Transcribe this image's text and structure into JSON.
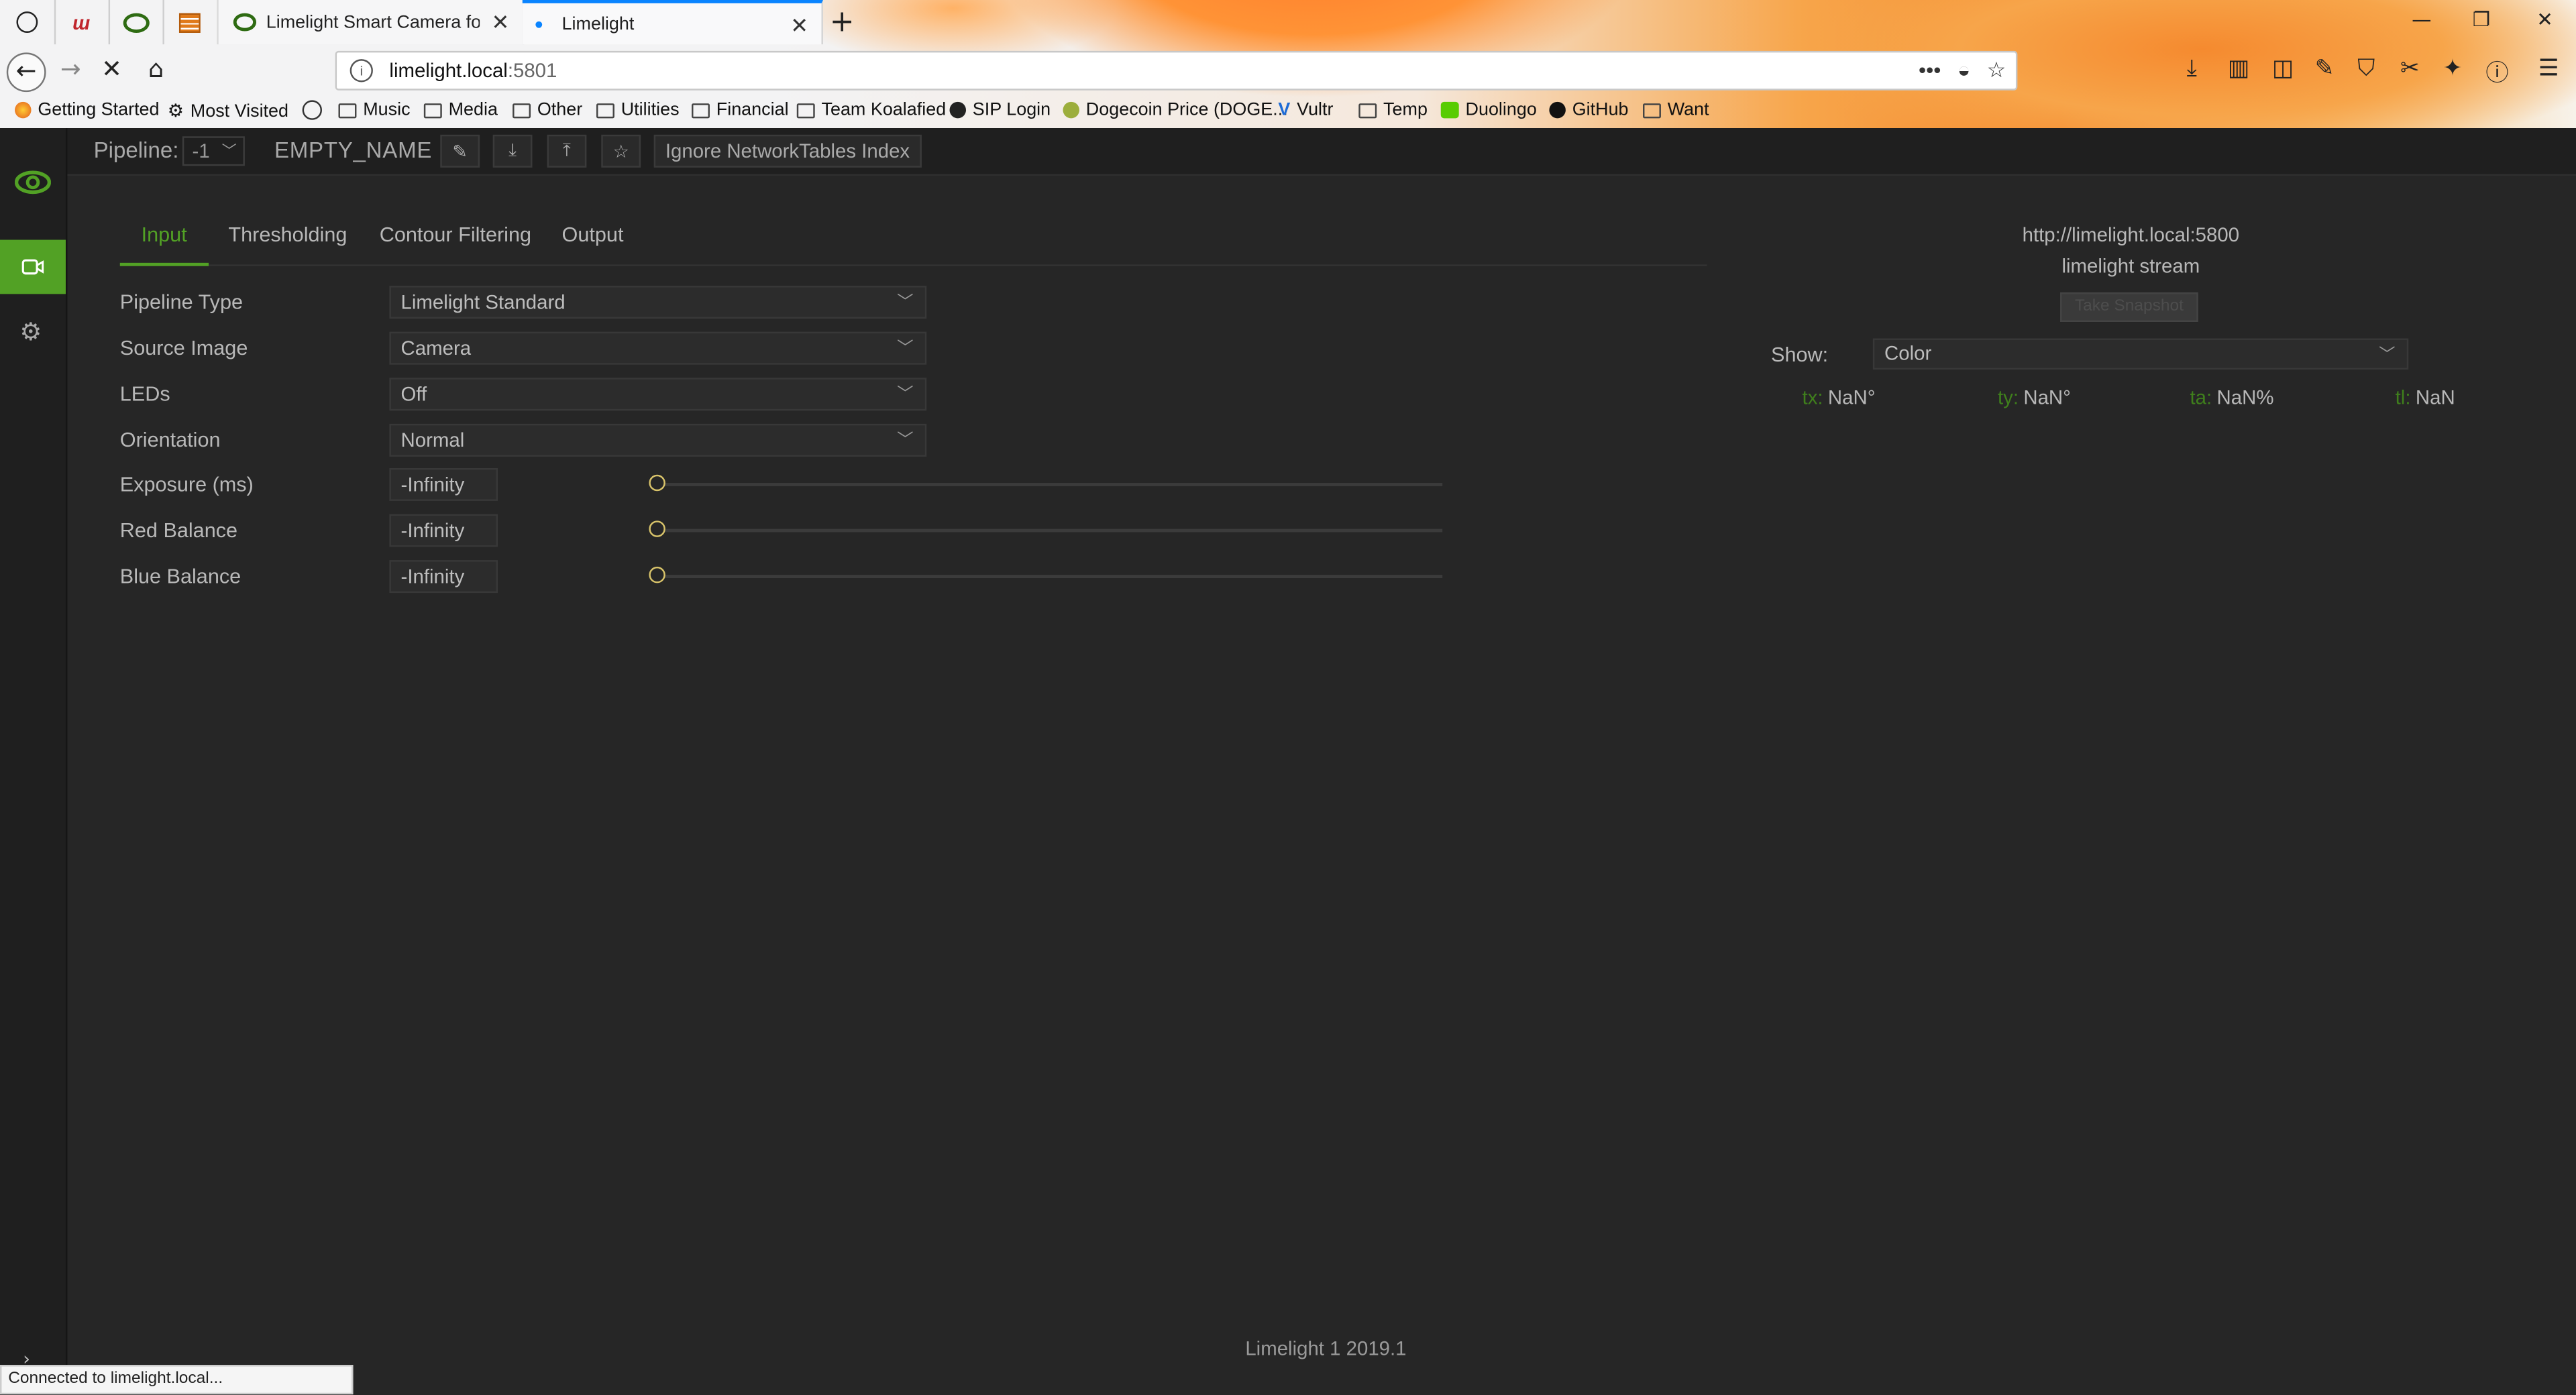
{
  "browser": {
    "tabs": [
      {
        "title": "",
        "icon": "globe-icon",
        "pinned": true
      },
      {
        "title": "",
        "icon": "red-app-icon",
        "pinned": true
      },
      {
        "title": "",
        "icon": "limelight-eye-icon",
        "pinned": true
      },
      {
        "title": "",
        "icon": "orange-app-icon",
        "pinned": true
      },
      {
        "title": "Limelight Smart Camera for FRC",
        "icon": "limelight-eye-icon",
        "pinned": false
      },
      {
        "title": "Limelight",
        "icon": "loading-dot-icon",
        "pinned": false,
        "active": true
      }
    ],
    "url_host": "limelight.local",
    "url_port": ":5801",
    "bookmarks": [
      {
        "label": "Getting Started",
        "icon": "firefox-icon"
      },
      {
        "label": "Most Visited",
        "icon": "gear-icon"
      },
      {
        "label": "",
        "icon": "globe-icon"
      },
      {
        "label": "Music",
        "icon": "folder-icon"
      },
      {
        "label": "Media",
        "icon": "folder-icon"
      },
      {
        "label": "Other",
        "icon": "folder-icon"
      },
      {
        "label": "Utilities",
        "icon": "folder-icon"
      },
      {
        "label": "Financial",
        "icon": "folder-icon"
      },
      {
        "label": "Team Koalafied",
        "icon": "folder-icon"
      },
      {
        "label": "SIP Login",
        "icon": "sip-icon"
      },
      {
        "label": "Dogecoin Price (DOGE...",
        "icon": "dogecoin-icon"
      },
      {
        "label": "Vultr",
        "icon": "vultr-icon"
      },
      {
        "label": "Temp",
        "icon": "folder-icon"
      },
      {
        "label": "Duolingo",
        "icon": "duolingo-icon"
      },
      {
        "label": "GitHub",
        "icon": "github-icon"
      },
      {
        "label": "Want",
        "icon": "folder-icon"
      }
    ],
    "status_text": "Connected to limelight.local..."
  },
  "topbar": {
    "pipeline_label": "Pipeline:",
    "pipeline_index": "-1",
    "pipeline_name": "EMPTY_NAME",
    "ignore_nt_label": "Ignore NetworkTables Index"
  },
  "tabs": [
    "Input",
    "Thresholding",
    "Contour Filtering",
    "Output"
  ],
  "form": {
    "pipeline_type": {
      "label": "Pipeline Type",
      "value": "Limelight Standard"
    },
    "source_image": {
      "label": "Source Image",
      "value": "Camera"
    },
    "leds": {
      "label": "LEDs",
      "value": "Off"
    },
    "orientation": {
      "label": "Orientation",
      "value": "Normal"
    },
    "exposure": {
      "label": "Exposure (ms)",
      "value": "-Infinity"
    },
    "red_balance": {
      "label": "Red Balance",
      "value": "-Infinity"
    },
    "blue_balance": {
      "label": "Blue Balance",
      "value": "-Infinity"
    }
  },
  "stream": {
    "url": "http://limelight.local:5800",
    "name": "limelight stream",
    "snapshot_label": "Take Snapshot",
    "show_label": "Show:",
    "show_value": "Color",
    "stats": [
      {
        "key": "tx:",
        "value": "NaN°"
      },
      {
        "key": "ty:",
        "value": "NaN°"
      },
      {
        "key": "ta:",
        "value": "NaN%"
      },
      {
        "key": "tl:",
        "value": "NaN"
      }
    ]
  },
  "footer": "Limelight 1 2019.1",
  "colors": {
    "accent": "#52a125",
    "background": "#262626",
    "slider_thumb": "#d8c36a"
  }
}
